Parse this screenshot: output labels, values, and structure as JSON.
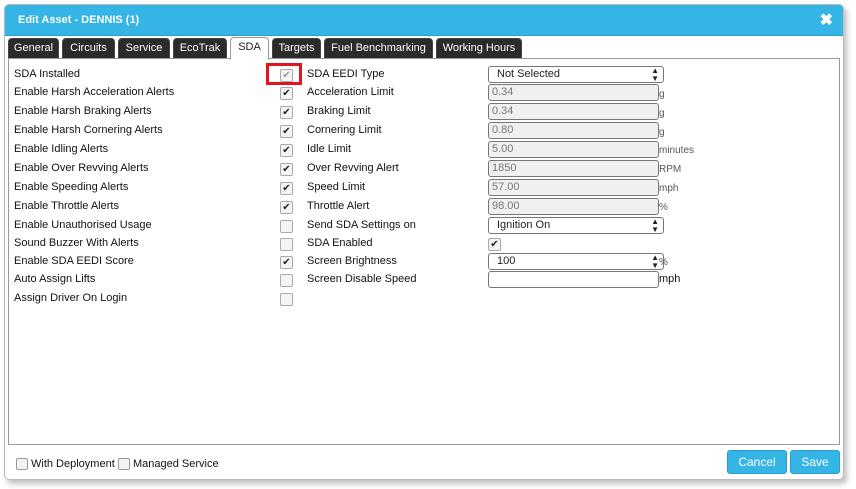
{
  "dialog": {
    "title": "Edit Asset - DENNIS (1)",
    "close_glyph": "✖"
  },
  "tabs": [
    "General",
    "Circuits",
    "Service",
    "EcoTrak",
    "SDA",
    "Targets",
    "Fuel Benchmarking",
    "Working Hours"
  ],
  "active_tab": "SDA",
  "left_options": [
    {
      "label": "SDA Installed",
      "checked": true,
      "disabled": true
    },
    {
      "label": "Enable Harsh Acceleration Alerts",
      "checked": true
    },
    {
      "label": "Enable Harsh Braking Alerts",
      "checked": true
    },
    {
      "label": "Enable Harsh Cornering Alerts",
      "checked": true
    },
    {
      "label": "Enable Idling Alerts",
      "checked": true
    },
    {
      "label": "Enable Over Revving Alerts",
      "checked": true
    },
    {
      "label": "Enable Speeding Alerts",
      "checked": true
    },
    {
      "label": "Enable Throttle Alerts",
      "checked": true
    },
    {
      "label": "Enable Unauthorised Usage",
      "checked": false
    },
    {
      "label": "Sound Buzzer With Alerts",
      "checked": false
    },
    {
      "label": "Enable SDA EEDI Score",
      "checked": true
    },
    {
      "label": "Auto Assign Lifts",
      "checked": false
    },
    {
      "label": "Assign Driver On Login",
      "checked": false
    }
  ],
  "right_fields": [
    {
      "label": "SDA EEDI Type",
      "kind": "select",
      "value": "Not Selected",
      "unit": ""
    },
    {
      "label": "Acceleration Limit",
      "kind": "input",
      "value": "0.34",
      "unit": "g"
    },
    {
      "label": "Braking Limit",
      "kind": "input",
      "value": "0.34",
      "unit": "g"
    },
    {
      "label": "Cornering Limit",
      "kind": "input",
      "value": "0.80",
      "unit": "g"
    },
    {
      "label": "Idle Limit",
      "kind": "input",
      "value": "5.00",
      "unit": "minutes"
    },
    {
      "label": "Over Revving Alert",
      "kind": "input",
      "value": "1850",
      "unit": "RPM"
    },
    {
      "label": "Speed Limit",
      "kind": "input",
      "value": "57.00",
      "unit": "mph"
    },
    {
      "label": "Throttle Alert",
      "kind": "input",
      "value": "98.00",
      "unit": "%"
    },
    {
      "label": "Send SDA Settings on",
      "kind": "select",
      "value": "Ignition On",
      "unit": ""
    },
    {
      "label": "SDA Enabled",
      "kind": "checkbox",
      "checked": true,
      "unit": ""
    },
    {
      "label": "Screen Brightness",
      "kind": "select",
      "value": "100",
      "unit": "%"
    },
    {
      "label": "Screen Disable Speed",
      "kind": "input-editable",
      "value": "",
      "unit": "mph"
    }
  ],
  "footer": {
    "with_deployment_label": "With Deployment",
    "managed_service_label": "Managed Service",
    "cancel_label": "Cancel",
    "save_label": "Save"
  },
  "check_glyph": "✔",
  "colors": {
    "accent": "#35b5e5",
    "highlight": "#e4141e",
    "tab_dark": "#2b2b2b"
  }
}
